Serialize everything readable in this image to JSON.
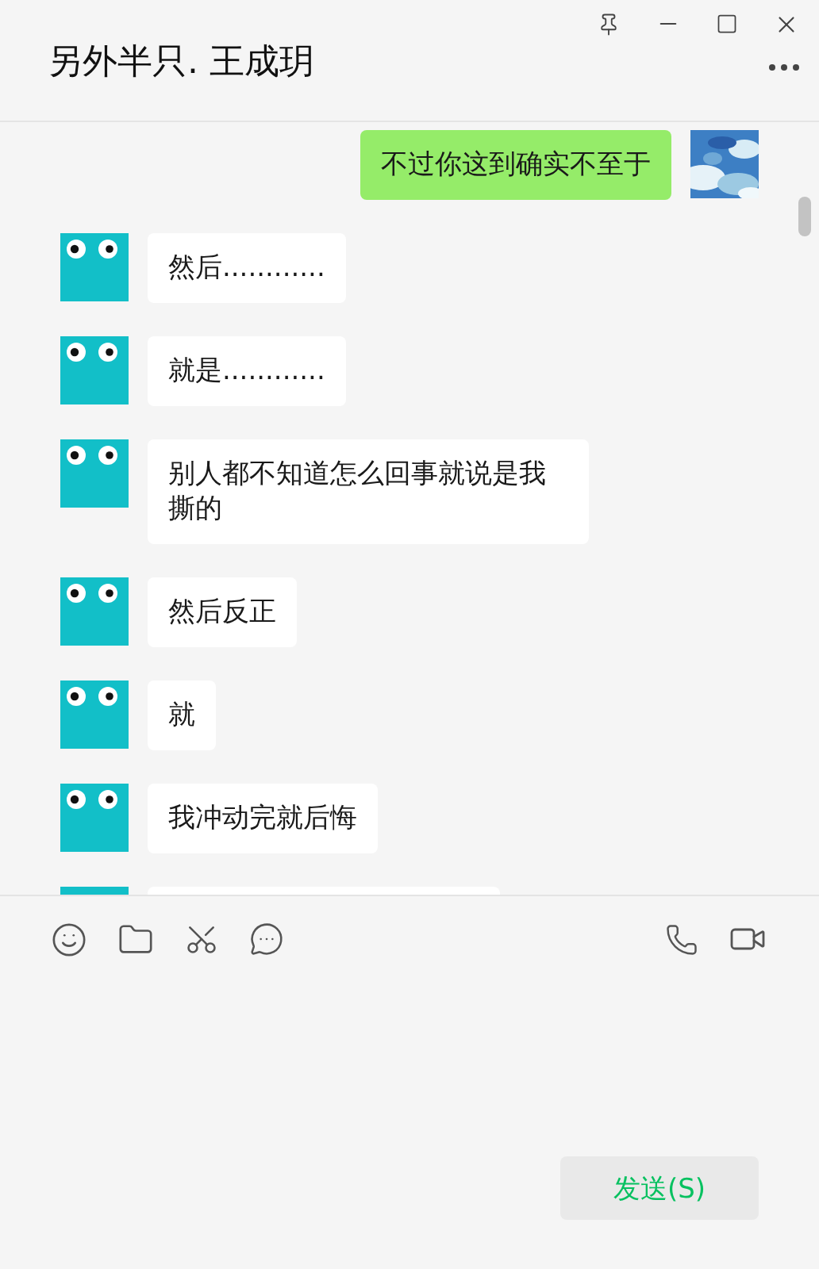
{
  "window": {
    "title": "另外半只. 王成玥"
  },
  "messages": [
    {
      "kind": "sent",
      "text": "不过你这到确实不至于"
    },
    {
      "kind": "received",
      "text": "然后............"
    },
    {
      "kind": "received",
      "text": "就是............"
    },
    {
      "kind": "received",
      "text": "别人都不知道怎么回事就说是我撕的"
    },
    {
      "kind": "received",
      "text": "然后反正"
    },
    {
      "kind": "received",
      "text": "就"
    },
    {
      "kind": "received",
      "text": "我冲动完就后悔"
    },
    {
      "kind": "cut"
    }
  ],
  "send_button": "发送(S)"
}
